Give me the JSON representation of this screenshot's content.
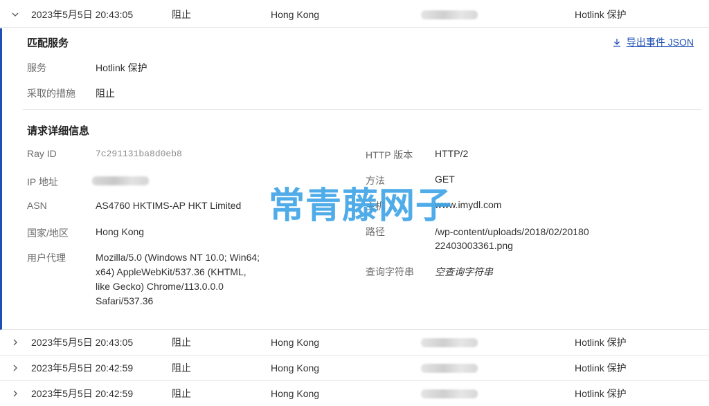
{
  "rows": [
    {
      "date": "2023年5月5日 20:43:05",
      "action": "阻止",
      "country": "Hong Kong",
      "service": "Hotlink 保护"
    },
    {
      "date": "2023年5月5日 20:43:05",
      "action": "阻止",
      "country": "Hong Kong",
      "service": "Hotlink 保护"
    },
    {
      "date": "2023年5月5日 20:42:59",
      "action": "阻止",
      "country": "Hong Kong",
      "service": "Hotlink 保护"
    },
    {
      "date": "2023年5月5日 20:42:59",
      "action": "阻止",
      "country": "Hong Kong",
      "service": "Hotlink 保护"
    }
  ],
  "detail": {
    "export_label": "导出事件 JSON",
    "matched": {
      "title": "匹配服务",
      "service_label": "服务",
      "service_value": "Hotlink 保护",
      "action_label": "采取的措施",
      "action_value": "阻止"
    },
    "request": {
      "title": "请求详细信息",
      "ray_label": "Ray ID",
      "ray_value": "7c291131ba8d0eb8",
      "ip_label": "IP 地址",
      "asn_label": "ASN",
      "asn_value": "AS4760 HKTIMS-AP HKT Limited",
      "country_label": "国家/地区",
      "country_value": "Hong Kong",
      "ua_label": "用户代理",
      "ua_lines": [
        "Mozilla/5.0 (Windows NT 10.0; Win64;",
        "x64) AppleWebKit/537.36 (KHTML,",
        "like Gecko) Chrome/113.0.0.0",
        "Safari/537.36"
      ],
      "http_label": "HTTP 版本",
      "http_value": "HTTP/2",
      "method_label": "方法",
      "method_value": "GET",
      "host_label": "主机",
      "host_value": "www.imydl.com",
      "path_label": "路径",
      "path_lines": [
        "/wp-content/uploads/2018/02/20180",
        "22403003361.png"
      ],
      "query_label": "查询字符串",
      "query_value": "空查询字符串"
    }
  },
  "watermark": "常青藤网子",
  "colors": {
    "accent": "#1d4fb5",
    "watermark": "#38a0e6"
  }
}
